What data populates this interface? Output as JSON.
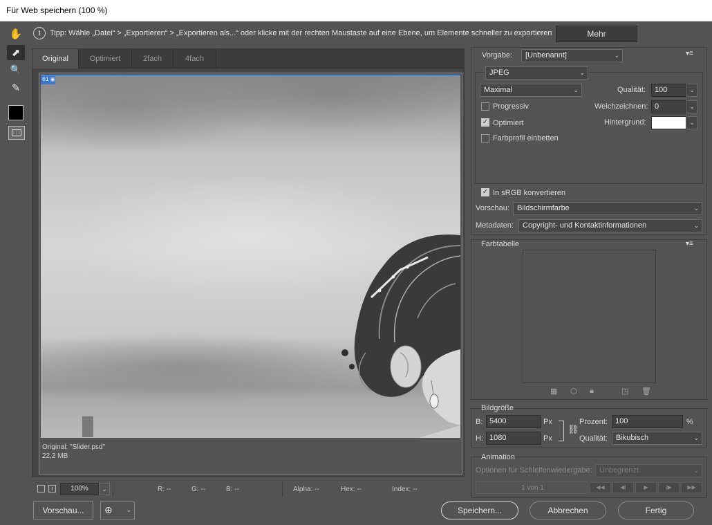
{
  "window": {
    "title": "Für Web speichern (100 %)"
  },
  "tools": [
    {
      "name": "hand-tool-icon",
      "glyph": "✋"
    },
    {
      "name": "slice-select-tool-icon",
      "glyph": "⬈"
    },
    {
      "name": "zoom-tool-icon",
      "glyph": "🔍"
    },
    {
      "name": "eyedropper-tool-icon",
      "glyph": "✎"
    }
  ],
  "tip": {
    "icon": "i",
    "text": "Tipp: Wähle „Datei“ > „Exportieren“ > „Exportieren als...“ oder klicke mit der rechten Maustaste auf eine Ebene, um Elemente schneller zu exportieren",
    "more_label": "Mehr"
  },
  "preview": {
    "tabs": [
      {
        "label": "Original"
      },
      {
        "label": "Optimiert"
      },
      {
        "label": "2fach"
      },
      {
        "label": "4fach"
      }
    ],
    "badge": "01",
    "info_line1": "Original: \"Slider.psd\"",
    "info_line2": "22,2 MB"
  },
  "status": {
    "zoom": "100%",
    "r": "R: --",
    "g": "G: --",
    "b": "B: --",
    "alpha": "Alpha: --",
    "hex": "Hex: --",
    "index": "Index: --"
  },
  "buttons": {
    "preview": "Vorschau...",
    "save": "Speichern...",
    "cancel": "Abbrechen",
    "done": "Fertig"
  },
  "settings": {
    "preset_label": "Vorgabe:",
    "preset_value": "[Unbenannt]",
    "format": "JPEG",
    "quality_preset": "Maximal",
    "quality_label": "Qualität:",
    "quality_value": "100",
    "progressive_label": "Progressiv",
    "progressive_checked": false,
    "blur_label": "Weichzeichnen:",
    "blur_value": "0",
    "optimized_label": "Optimiert",
    "optimized_checked": true,
    "matte_label": "Hintergrund:",
    "matte_color": "#ffffff",
    "embed_profile_label": "Farbprofil einbetten",
    "embed_profile_checked": false,
    "srgb_label": "In sRGB konvertieren",
    "srgb_checked": true,
    "preview_label": "Vorschau:",
    "preview_value": "Bildschirmfarbe",
    "metadata_label": "Metadaten:",
    "metadata_value": "Copyright- und Kontaktinformationen"
  },
  "colortable": {
    "title": "Farbtabelle"
  },
  "imagesize": {
    "title": "Bildgröße",
    "w_label": "B:",
    "w_value": "5400",
    "h_label": "H:",
    "h_value": "1080",
    "unit": "Px",
    "percent_label": "Prozent:",
    "percent_value": "100",
    "percent_unit": "%",
    "quality_label": "Qualität:",
    "quality_value": "Bikubisch"
  },
  "animation": {
    "title": "Animation",
    "loop_label": "Optionen für Schleifenwiedergabe:",
    "loop_value": "Unbegrenzt",
    "frame_counter": "1 von 1"
  }
}
